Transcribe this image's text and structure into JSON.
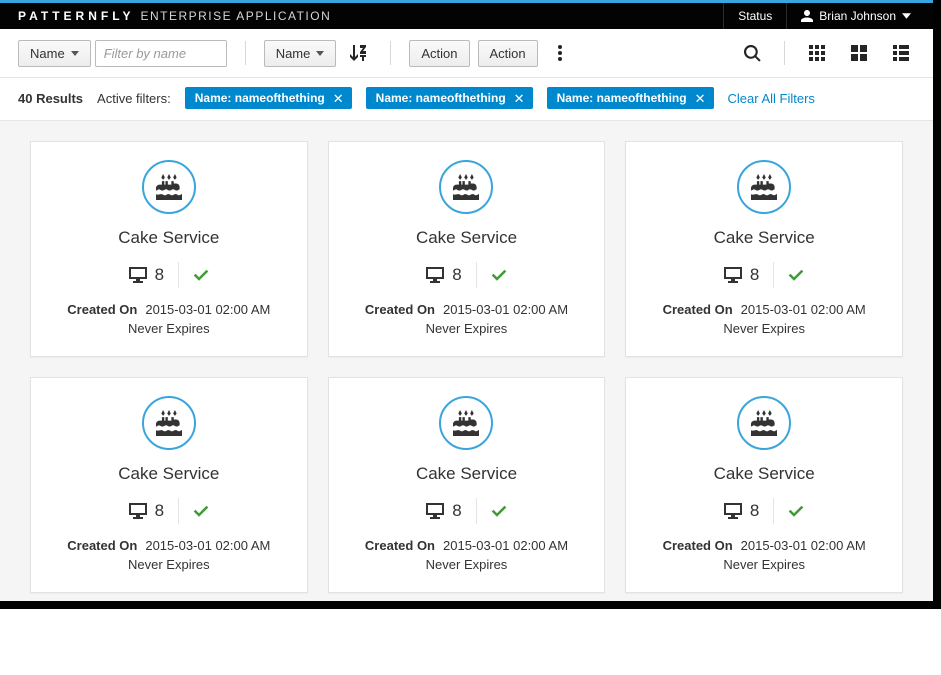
{
  "brand": {
    "logo": "PATTERNFLY",
    "app": "ENTERPRISE APPLICATION"
  },
  "header": {
    "status": "Status",
    "user": "Brian Johnson"
  },
  "toolbar": {
    "filter_field": "Name",
    "filter_placeholder": "Filter by name",
    "sort_field": "Name",
    "action1": "Action",
    "action2": "Action"
  },
  "filters": {
    "results_count": "40 Results",
    "active_label": "Active filters:",
    "chips": [
      {
        "label": "Name: nameofthething"
      },
      {
        "label": "Name: nameofthething"
      },
      {
        "label": "Name: nameofthething"
      }
    ],
    "clear": "Clear All Filters"
  },
  "cards": [
    {
      "title": "Cake Service",
      "count": "8",
      "created_label": "Created On",
      "created": "2015-03-01 02:00 AM",
      "expires": "Never Expires"
    },
    {
      "title": "Cake Service",
      "count": "8",
      "created_label": "Created On",
      "created": "2015-03-01 02:00 AM",
      "expires": "Never Expires"
    },
    {
      "title": "Cake Service",
      "count": "8",
      "created_label": "Created On",
      "created": "2015-03-01 02:00 AM",
      "expires": "Never Expires"
    },
    {
      "title": "Cake Service",
      "count": "8",
      "created_label": "Created On",
      "created": "2015-03-01 02:00 AM",
      "expires": "Never Expires"
    },
    {
      "title": "Cake Service",
      "count": "8",
      "created_label": "Created On",
      "created": "2015-03-01 02:00 AM",
      "expires": "Never Expires"
    },
    {
      "title": "Cake Service",
      "count": "8",
      "created_label": "Created On",
      "created": "2015-03-01 02:00 AM",
      "expires": "Never Expires"
    }
  ]
}
